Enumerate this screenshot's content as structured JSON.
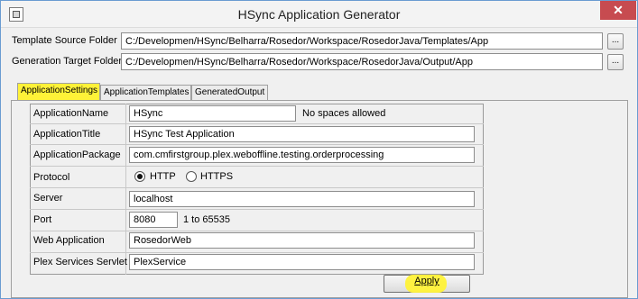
{
  "window": {
    "title": "HSync Application Generator",
    "close_glyph": "✕",
    "accent_color": "#c74b50"
  },
  "paths": {
    "template_label": "Template Source Folder",
    "template_value": "C:/Developmen/HSync/Belharra/Rosedor/Workspace/RosedorJava/Templates/App",
    "target_label": "Generation Target Folder",
    "target_value": "C:/Developmen/HSync/Belharra/Rosedor/Workspace/RosedorJava/Output/App",
    "browse_label": "..."
  },
  "tabs": [
    {
      "label": "ApplicationSettings",
      "active": true
    },
    {
      "label": "ApplicationTemplates",
      "active": false
    },
    {
      "label": "GeneratedOutput",
      "active": false
    }
  ],
  "form": {
    "app_name": {
      "label": "ApplicationName",
      "value": "HSync",
      "hint": "No spaces allowed"
    },
    "app_title": {
      "label": "ApplicationTitle",
      "value": "HSync Test Application"
    },
    "app_package": {
      "label": "ApplicationPackage",
      "value": "com.cmfirstgroup.plex.weboffline.testing.orderprocessing"
    },
    "protocol": {
      "label": "Protocol",
      "options": [
        "HTTP",
        "HTTPS"
      ],
      "selected": "HTTP"
    },
    "server": {
      "label": "Server",
      "value": "localhost"
    },
    "port": {
      "label": "Port",
      "value": "8080",
      "hint": "1 to 65535"
    },
    "web_application": {
      "label": "Web Application",
      "value": "RosedorWeb"
    },
    "servlet": {
      "label": "Plex Services Servlet",
      "value": "PlexService"
    }
  },
  "apply_label": "Apply",
  "highlight_color": "#fff238"
}
